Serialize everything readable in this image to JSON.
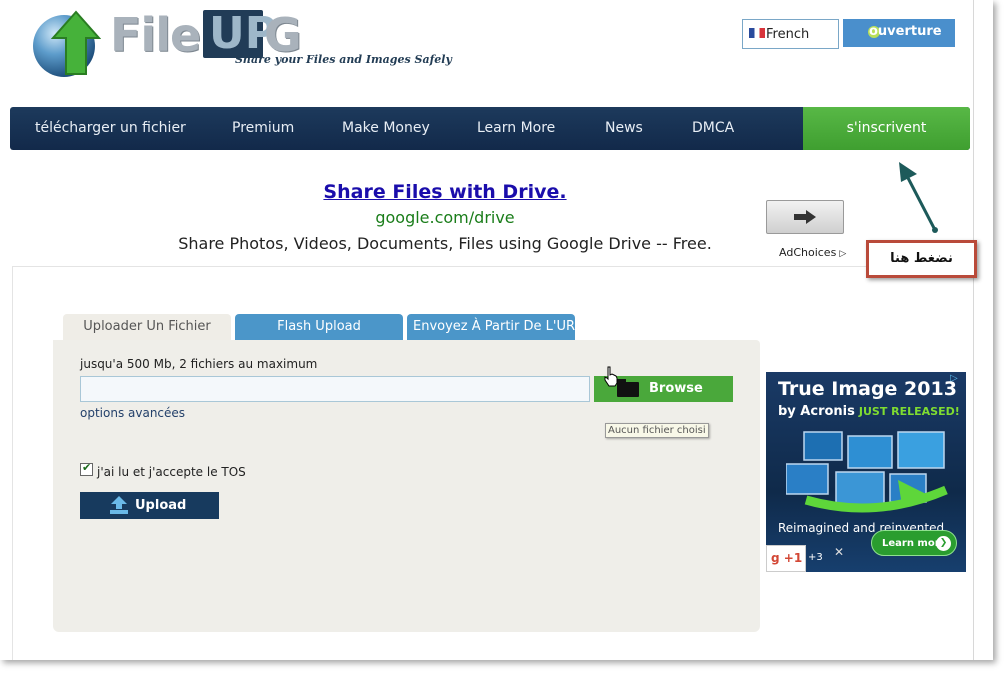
{
  "logo": {
    "file_text": "File",
    "up_text": "UP",
    "g_text": "G",
    "tagline": "Share your Files and Images Safely"
  },
  "header": {
    "language": "French",
    "login_label": "ouverture"
  },
  "nav": {
    "items": [
      "télécharger un fichier",
      "Premium",
      "Make Money",
      "Learn More",
      "News",
      "DMCA"
    ],
    "signup": "s'inscrivent"
  },
  "annotation": {
    "text": "نضغط هنا"
  },
  "ad": {
    "title": "Share Files with Drive.",
    "url": "google.com/drive",
    "description": "Share Photos, Videos, Documents, Files using Google Drive -- Free.",
    "adchoices": "AdChoices"
  },
  "upload": {
    "tabs": [
      "Uploader Un Fichier",
      "Flash Upload",
      "Envoyez À Partir De L'URL"
    ],
    "limit_text": "jusqu'a 500 Mb, 2 fichiers au maximum",
    "browse_label": "Browse",
    "tooltip": "Aucun fichier choisi",
    "advanced_options": "options avancées",
    "tos_label": "j'ai lu et j'accepte le TOS",
    "tos_checked": true,
    "upload_label": "Upload"
  },
  "side_ad": {
    "title": "True Image 2013",
    "by": "by Acronis",
    "badge": "JUST RELEASED!",
    "body": "Reimagined and reinvented",
    "learn_more": "Learn more",
    "gplus": "+1",
    "gplus_count": "+3"
  }
}
